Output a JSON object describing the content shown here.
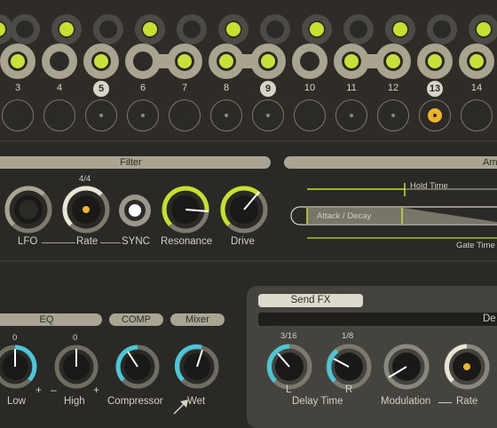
{
  "sequencer": {
    "step_numbers": [
      "3",
      "4",
      "5",
      "6",
      "7",
      "8",
      "9",
      "10",
      "11",
      "12",
      "13",
      "14"
    ],
    "highlighted_steps": [
      "5",
      "9",
      "13"
    ]
  },
  "filter": {
    "title": "Filter",
    "rate_value": "4/4",
    "knobs": {
      "lfo": "LFO",
      "rate": "Rate",
      "sync": "SYNC",
      "resonance": "Resonance",
      "drive": "Drive"
    }
  },
  "amp": {
    "title": "Am",
    "hold_time": "Hold Time",
    "attack_decay": "Attack / Decay",
    "gate_time": "Gate Time"
  },
  "eq": {
    "title": "EQ",
    "low_value": "0",
    "high_value": "0",
    "low": "Low",
    "high": "High",
    "plus": "+",
    "minus": "–"
  },
  "comp": {
    "title": "COMP",
    "compressor": "Compressor"
  },
  "mixer": {
    "title": "Mixer",
    "wet": "Wet"
  },
  "send_fx": {
    "title": "Send FX",
    "delay_title": "De",
    "left_value": "3/16",
    "right_value": "1/8",
    "l": "L",
    "r": "R",
    "delay_time": "Delay Time",
    "modulation": "Modulation",
    "rate": "Rate"
  },
  "colors": {
    "accent_green": "#c7df2f",
    "accent_cyan": "#48c8d8",
    "accent_orange": "#f0b52a"
  }
}
